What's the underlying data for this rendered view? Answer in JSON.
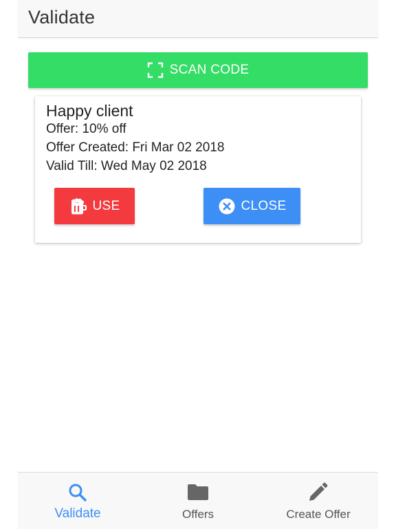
{
  "header": {
    "title": "Validate"
  },
  "scan": {
    "label": "SCAN CODE",
    "icon": "scan-frame-icon",
    "color": "#33dd66"
  },
  "card": {
    "title": "Happy client",
    "offer": "Offer: 10% off",
    "created": "Offer Created: Fri Mar 02 2018",
    "valid_till": "Valid Till: Wed May 02 2018",
    "use_button": {
      "label": "USE",
      "icon": "beer-mug-icon",
      "color": "#f23a3f"
    },
    "close_button": {
      "label": "CLOSE",
      "icon": "close-circle-icon",
      "color": "#3d8ef5"
    }
  },
  "tabbar": {
    "tabs": [
      {
        "label": "Validate",
        "icon": "search-icon",
        "active": true
      },
      {
        "label": "Offers",
        "icon": "folder-icon",
        "active": false
      },
      {
        "label": "Create Offer",
        "icon": "pencil-icon",
        "active": false
      }
    ],
    "active_color": "#3d8ef5",
    "inactive_color": "#555555"
  }
}
